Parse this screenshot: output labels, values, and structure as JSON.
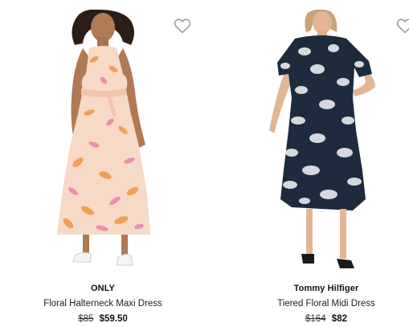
{
  "products": [
    {
      "brand": "ONLY",
      "title": "Floral Halterneck Maxi Dress",
      "original_price": "$85",
      "sale_price": "$59.50",
      "image_icon": "floral-halter-maxi-dress-photo",
      "wishlist_icon": "heart-icon",
      "dress_colors": {
        "base": "#f7d9c8",
        "flower_orange": "#ef9a4a",
        "flower_pink": "#e883a6"
      }
    },
    {
      "brand": "Tommy Hilfiger",
      "title": "Tiered Floral Midi Dress",
      "original_price": "$164",
      "sale_price": "$82",
      "image_icon": "tiered-floral-midi-dress-photo",
      "wishlist_icon": "heart-icon",
      "dress_colors": {
        "base": "#1d2b3c",
        "flower": "#e8ecef"
      }
    }
  ]
}
